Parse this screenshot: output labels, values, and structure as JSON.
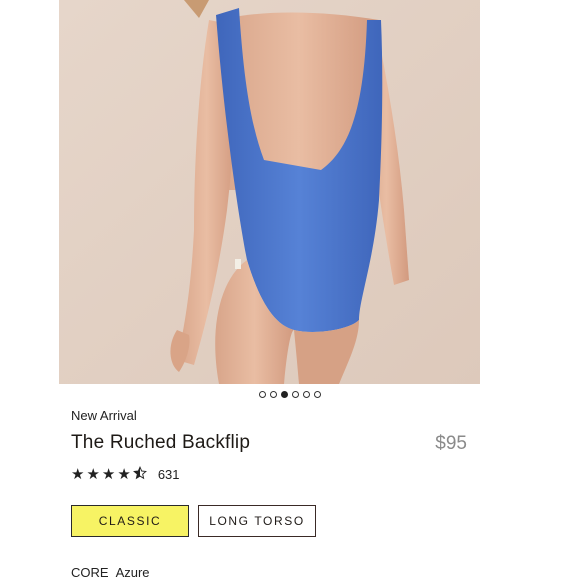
{
  "carousel": {
    "slide_count": 6,
    "active_index": 2
  },
  "product": {
    "tag": "New Arrival",
    "title": "The Ruched Backflip",
    "price": "$95",
    "rating": 4.5,
    "review_count": "631"
  },
  "options": {
    "fit": [
      "CLASSIC",
      "LONG TORSO"
    ],
    "selected": "CLASSIC"
  },
  "color": {
    "collection": "CORE",
    "name": "Azure"
  },
  "colors": {
    "swimsuit": "#4f78cf",
    "selected_option_bg": "#f7f364",
    "price": "#8a8a8a",
    "photo_bg": "#e3d2c6"
  },
  "icons": {
    "star_full": "star-icon",
    "star_half": "star-half-icon"
  }
}
